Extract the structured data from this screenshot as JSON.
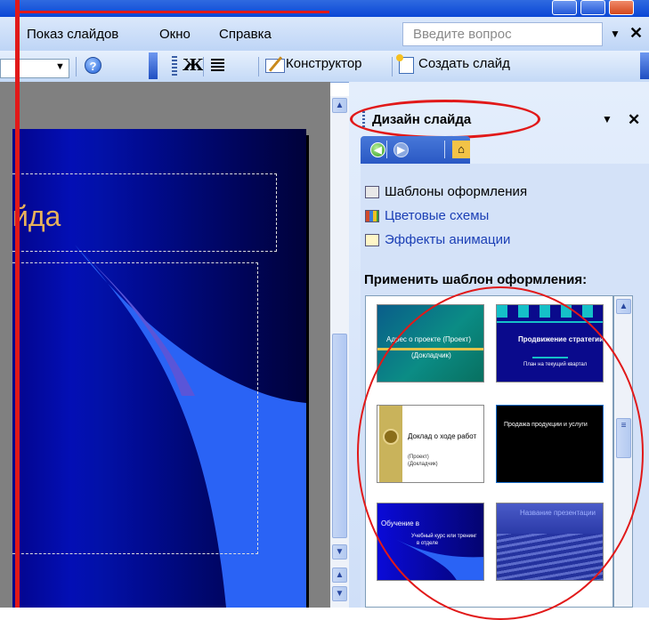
{
  "menubar": {
    "slideshow": "Показ слайдов",
    "window": "Окно",
    "help": "Справка",
    "help_box_placeholder": "Введите вопрос"
  },
  "toolbar": {
    "bold": "Ж",
    "design": "Конструктор",
    "new_slide": "Создать слайд"
  },
  "slide": {
    "title_fragment": "йда"
  },
  "taskpane": {
    "title": "Дизайн слайда",
    "links": [
      {
        "label": "Шаблоны оформления",
        "icon": "templates-icon"
      },
      {
        "label": "Цветовые схемы",
        "icon": "color-scheme-icon"
      },
      {
        "label": "Эффекты анимации",
        "icon": "animation-icon"
      }
    ],
    "apply_label": "Применить шаблон оформления:",
    "thumbnails": [
      {
        "lines": [
          "Адрес о проекте (Проект)",
          "(Докладчик)"
        ]
      },
      {
        "lines": [
          "Продвижение стратегии",
          "План на текущий квартал"
        ]
      },
      {
        "lines": [
          "Доклад о ходе работ",
          "(Проект)",
          "(Докладчик)"
        ]
      },
      {
        "lines": [
          "Продажа продукции и услуги"
        ]
      },
      {
        "lines": [
          "Обучение в",
          "Учебный курс или тренинг",
          "в отделе"
        ]
      },
      {
        "lines": [
          "Название презентации"
        ]
      }
    ]
  }
}
